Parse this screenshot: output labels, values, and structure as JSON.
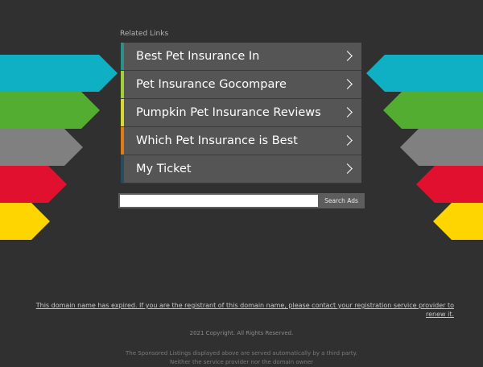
{
  "related_links": {
    "heading": "Related Links",
    "items": [
      {
        "label": "Best Pet Insurance In",
        "accent": "#2e8f88"
      },
      {
        "label": "Pet Insurance Gocompare",
        "accent": "#a4cf3b"
      },
      {
        "label": "Pumpkin Pet Insurance Reviews",
        "accent": "#d9d936"
      },
      {
        "label": "Which Pet Insurance is Best",
        "accent": "#e07b1a"
      },
      {
        "label": "My Ticket",
        "accent": "#2a4b5e"
      }
    ]
  },
  "search": {
    "placeholder": "",
    "button_label": "Search Ads"
  },
  "decor_arrows": {
    "colors": [
      "#0fb0c4",
      "#52ad31",
      "#808080",
      "#e0102e",
      "#ffd500"
    ]
  },
  "footer": {
    "expired_notice": "This domain name has expired. If you are the registrant of this domain name, please contact your registration service provider to renew it.",
    "copyright": "2021 Copyright. All Rights Reserved.",
    "disclaimer": "The Sponsored Listings displayed above are served automatically by a third party. Neither the service provider nor the domain owner"
  }
}
